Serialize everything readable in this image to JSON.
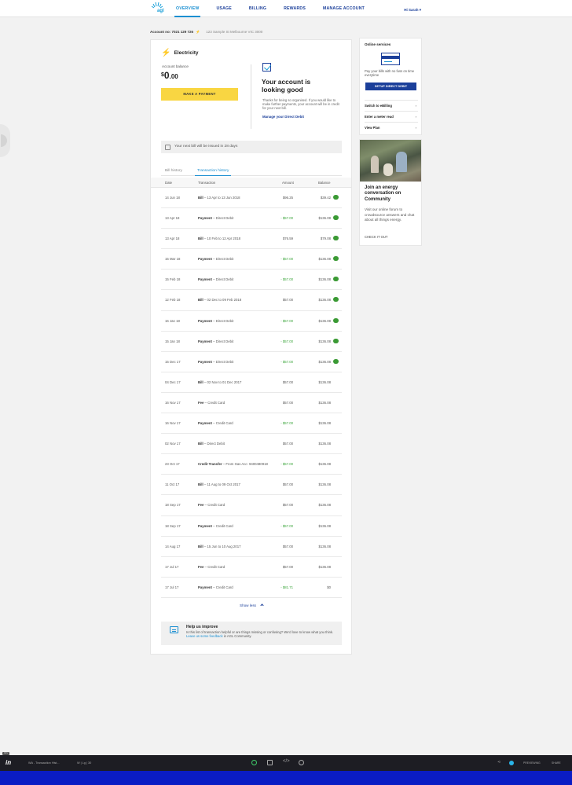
{
  "nav": {
    "logo_text": "agl",
    "tabs": [
      {
        "label": "OVERVIEW",
        "active": true
      },
      {
        "label": "USAGE",
        "active": false
      },
      {
        "label": "BILLING",
        "active": false
      },
      {
        "label": "REWARDS",
        "active": false
      },
      {
        "label": "MANAGE ACCOUNT",
        "active": false
      }
    ],
    "user_greeting": "Hi Sarah"
  },
  "account": {
    "label": "Account no:",
    "number": "7021 129 726",
    "address": "123 Sample St Melbourne VIC 3000"
  },
  "overview": {
    "product": "Electricity",
    "balance_label": "Account balance",
    "currency": "$",
    "balance_whole": "0",
    "balance_cents": ".00",
    "pay_button": "MAKE A PAYMENT",
    "status_title": "Your account is looking good",
    "status_text": "Thanks for being so organised. If you would like to make further payments, your account will be in credit for your next bill.",
    "status_link": "Manage your Direct Debit",
    "next_bill": "Your next bill will be issued in 28 days"
  },
  "tabs": {
    "bill_history": "Bill history",
    "transaction_history": "Transaction history",
    "active": "transaction_history"
  },
  "table": {
    "headers": {
      "date": "Date",
      "transaction": "Transaction",
      "amount": "Amount",
      "balance": "Balance"
    },
    "rows": [
      {
        "date": "14 Jun 18",
        "type": "Bill",
        "detail": "13 Apr to 13 Jun 2018",
        "amount": "$96.25",
        "credit": false,
        "balance": "$39.42",
        "chip": true
      },
      {
        "date": "13 Apr 18",
        "type": "Payment",
        "detail": "Direct Debit",
        "amount": "- $57.00",
        "credit": true,
        "balance": "$136.08",
        "chip": true
      },
      {
        "date": "13 Apr 18",
        "type": "Bill",
        "detail": "10 Feb to 12 Apr 2018",
        "amount": "$76.59",
        "credit": false,
        "balance": "$79.08",
        "chip": true
      },
      {
        "date": "15 Mar 18",
        "type": "Payment",
        "detail": "Direct Debit",
        "amount": "- $57.00",
        "credit": true,
        "balance": "$136.08",
        "chip": true
      },
      {
        "date": "15 Feb 18",
        "type": "Payment",
        "detail": "Direct Debit",
        "amount": "- $57.00",
        "credit": true,
        "balance": "$136.08",
        "chip": true
      },
      {
        "date": "12 Feb 18",
        "type": "Bill",
        "detail": "02 Dec to 09 Feb 2018",
        "amount": "$57.00",
        "credit": false,
        "balance": "$136.08",
        "chip": true
      },
      {
        "date": "16 Jan 18",
        "type": "Payment",
        "detail": "Direct Debit",
        "amount": "- $57.00",
        "credit": true,
        "balance": "$136.08",
        "chip": true
      },
      {
        "date": "15 Jan 18",
        "type": "Payment",
        "detail": "Direct Debit",
        "amount": "- $57.00",
        "credit": true,
        "balance": "$136.08",
        "chip": true
      },
      {
        "date": "15 Dec 17",
        "type": "Payment",
        "detail": "Direct Debit",
        "amount": "- $57.00",
        "credit": true,
        "balance": "$136.08",
        "chip": true
      },
      {
        "date": "04 Dec 17",
        "type": "Bill",
        "detail": "02 Nov to 01 Dec 2017",
        "amount": "$57.00",
        "credit": false,
        "balance": "$136.08",
        "chip": false
      },
      {
        "date": "16 Nov 17",
        "type": "Fee",
        "detail": "Credit Card",
        "amount": "$57.00",
        "credit": false,
        "balance": "$136.08",
        "chip": false
      },
      {
        "date": "16 Nov 17",
        "type": "Payment",
        "detail": "Credit Card",
        "amount": "- $57.00",
        "credit": true,
        "balance": "$136.08",
        "chip": false
      },
      {
        "date": "02 Nov 17",
        "type": "Bill",
        "detail": "Direct Debit",
        "amount": "$57.00",
        "credit": false,
        "balance": "$136.08",
        "chip": false
      },
      {
        "date": "23 Oct 17",
        "type": "Credit Transfer",
        "detail": "From Gas Acc: 9400480918",
        "amount": "- $57.00",
        "credit": true,
        "balance": "$136.08",
        "chip": false
      },
      {
        "date": "11 Oct 17",
        "type": "Bill",
        "detail": "11 Aug to 09 Oct 2017",
        "amount": "$57.00",
        "credit": false,
        "balance": "$136.08",
        "chip": false
      },
      {
        "date": "18 Sep 17",
        "type": "Fee",
        "detail": "Credit Card",
        "amount": "$57.00",
        "credit": false,
        "balance": "$136.08",
        "chip": false
      },
      {
        "date": "18 Sep 17",
        "type": "Payment",
        "detail": "Credit Card",
        "amount": "- $57.00",
        "credit": true,
        "balance": "$136.08",
        "chip": false
      },
      {
        "date": "14 Aug 17",
        "type": "Bill",
        "detail": "15 Jun to 10 Aug 2017",
        "amount": "$57.00",
        "credit": false,
        "balance": "$136.08",
        "chip": false
      },
      {
        "date": "17 Jul 17",
        "type": "Fee",
        "detail": "Credit Card",
        "amount": "$57.00",
        "credit": false,
        "balance": "$136.08",
        "chip": false
      },
      {
        "date": "17 Jul 17",
        "type": "Payment",
        "detail": "Credit Card",
        "amount": "- $81.71",
        "credit": true,
        "balance": "$0",
        "chip": false
      }
    ],
    "show_less": "Show less"
  },
  "help": {
    "title": "Help us improve",
    "text_before": "Is this list of transaction helpful or are things missing or confusing? We'd love to know what you think. ",
    "link": "Leave us some feedback",
    "text_after": " in AGL Community."
  },
  "side": {
    "online_title": "Online services",
    "online_text": "Pay your bills with no fuss on time everytime",
    "dd_button": "SETUP DIRECT DEBIT",
    "links": [
      "Switch to eBilling",
      "Enter a meter read",
      "View Plan"
    ],
    "community_title": "Join an energy conversation on Community",
    "community_text": "Visit our online forum to crowdsource answers and chat about all things energy.",
    "community_link": "CHECK IT OUT"
  },
  "proto_bar": {
    "badge": "DEV",
    "title": "WA - Transaction Hist...",
    "version": "W | Lg | 30",
    "right_1": "PREVIEWING",
    "right_2": "SHARE"
  },
  "colors": {
    "brand_navy": "#1b3f9a",
    "brand_blue": "#1b8fd1",
    "accent_yellow": "#f9d642",
    "credit_green": "#3aa53a"
  }
}
